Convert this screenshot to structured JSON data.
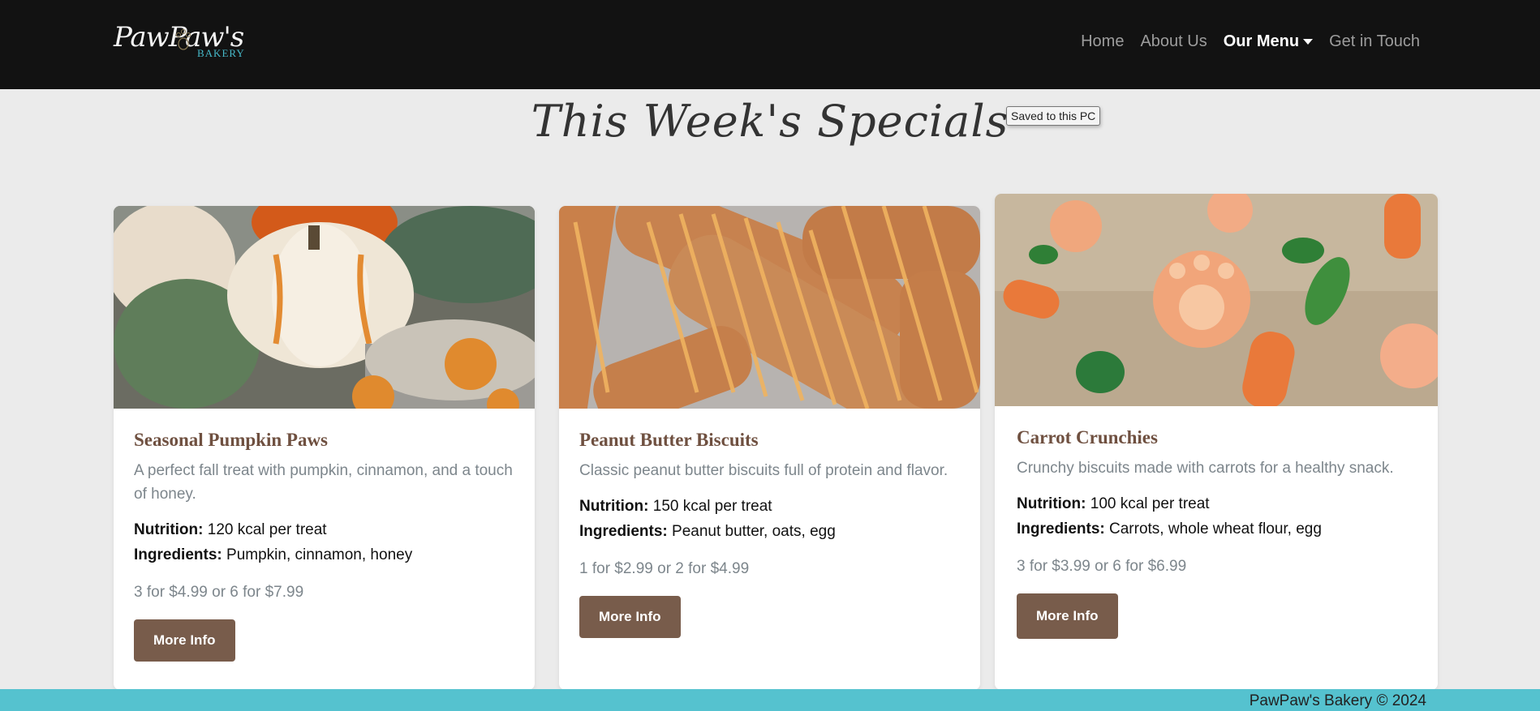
{
  "brand": {
    "logo_script": "PawPaw's",
    "logo_sub": "BAKERY"
  },
  "nav": {
    "items": [
      {
        "label": "Home"
      },
      {
        "label": "About Us"
      },
      {
        "label": "Our Menu",
        "active": true
      },
      {
        "label": "Get in Touch"
      }
    ]
  },
  "page": {
    "title": "This Week's Specials",
    "tooltip": "Saved to this PC"
  },
  "cards": [
    {
      "title": "Seasonal Pumpkin Paws",
      "description": "A perfect fall treat with pumpkin, cinnamon, and a touch of honey.",
      "nutrition_label": "Nutrition:",
      "nutrition": "120 kcal per treat",
      "ingredients_label": "Ingredients:",
      "ingredients": "Pumpkin, cinnamon, honey",
      "price": "3 for $4.99 or 6 for $7.99",
      "button": "More Info"
    },
    {
      "title": "Peanut Butter Biscuits",
      "description": "Classic peanut butter biscuits full of protein and flavor.",
      "nutrition_label": "Nutrition:",
      "nutrition": "150 kcal per treat",
      "ingredients_label": "Ingredients:",
      "ingredients": "Peanut butter, oats, egg",
      "price": "1 for $2.99 or 2 for $4.99",
      "button": "More Info"
    },
    {
      "title": "Carrot Crunchies",
      "description": "Crunchy biscuits made with carrots for a healthy snack.",
      "nutrition_label": "Nutrition:",
      "nutrition": "100 kcal per treat",
      "ingredients_label": "Ingredients:",
      "ingredients": "Carrots, whole wheat flour, egg",
      "price": "3 for $3.99 or 6 for $6.99",
      "button": "More Info"
    }
  ],
  "footer": {
    "text": "PawPaw's Bakery © 2024"
  },
  "colors": {
    "navbar": "#121212",
    "accent_brown": "#785c4b",
    "title_brown": "#6f5040",
    "footer": "#55c2cf",
    "logo_teal": "#46b8c8"
  }
}
